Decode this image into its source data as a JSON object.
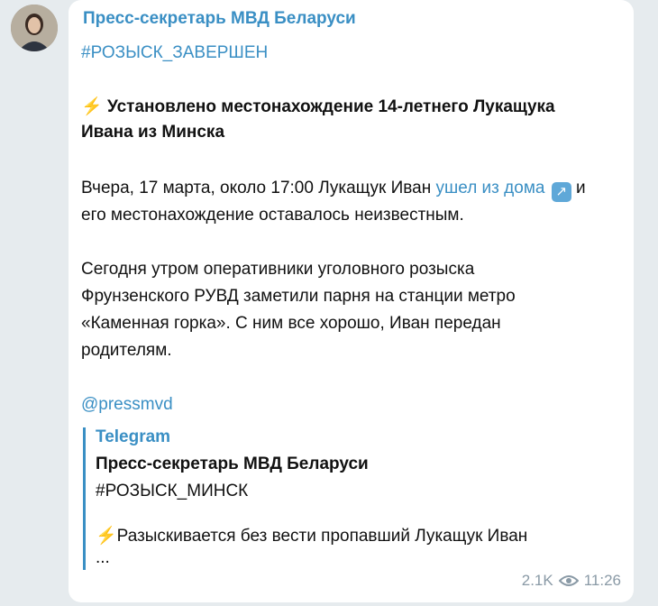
{
  "author": "Пресс-секретарь МВД Беларуси",
  "hashtag": "#РОЗЫСК_ЗАВЕРШЕН",
  "headline": {
    "icon": "lightning-icon",
    "line1": "Установлено местонахождение 14-летнего Лукащука",
    "line2": "Ивана из Минска"
  },
  "para1": {
    "line1_before": "Вчера, 17 марта, около 17:00 Лукащук Иван ",
    "line1_link": "ушел из дома",
    "line1_after": " и",
    "line2": "его местонахождение оставалось неизвестным."
  },
  "para2": {
    "line1": "Сегодня утром оперативники уголовного розыска",
    "line2": "Фрунзенского РУВД заметили парня на станции метро",
    "line3": "«Каменная горка». С ним все хорошо, Иван передан",
    "line4": "родителям."
  },
  "mention": "@pressmvd",
  "preview": {
    "site": "Telegram",
    "title": "Пресс-секретарь МВД Беларуси",
    "hashtag": "#РОЗЫСК_МИНСК",
    "text": "Разыскивается без вести пропавший Лукащук Иван",
    "ellipsis": "..."
  },
  "views": "2.1K",
  "time": "11:26",
  "colors": {
    "accent": "#3a8fc4",
    "background": "#e6ebee",
    "bubble": "#ffffff",
    "meta": "#8a9aa6"
  }
}
